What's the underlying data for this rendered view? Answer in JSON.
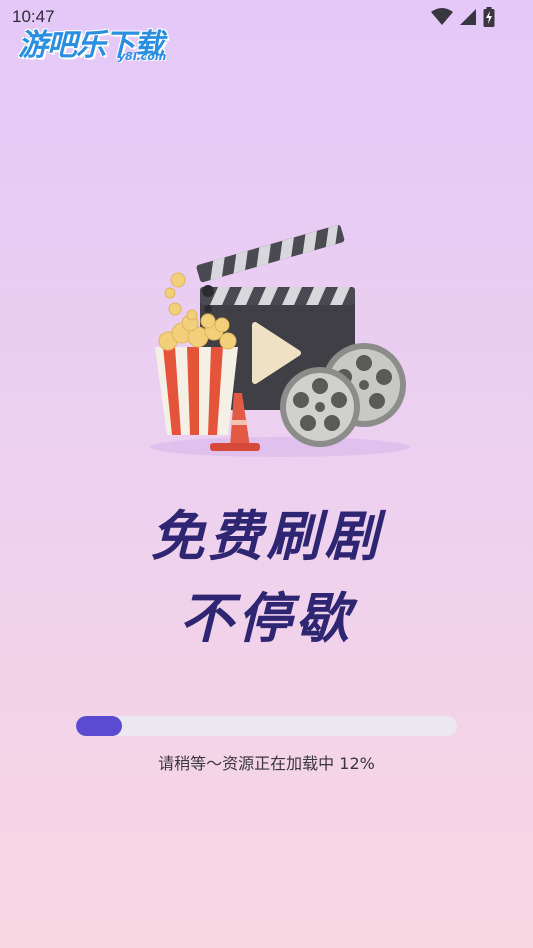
{
  "status_bar": {
    "time": "10:47",
    "icons": [
      "wifi-icon",
      "cellular-signal-icon",
      "battery-charging-icon"
    ]
  },
  "watermark": {
    "title": "游吧乐下载",
    "domain": "y8l.com"
  },
  "hero": {
    "illustration": "movie-clapperboard-popcorn-film-reels"
  },
  "slogan": {
    "line1": "免费刷剧",
    "line2": "不停歇"
  },
  "loading": {
    "progress_percent": 12,
    "text": "请稍等～资源正在加载中 12%"
  },
  "colors": {
    "accent": "#5a4bd1",
    "slogan": "#2e2672",
    "track": "#ece8f0"
  }
}
